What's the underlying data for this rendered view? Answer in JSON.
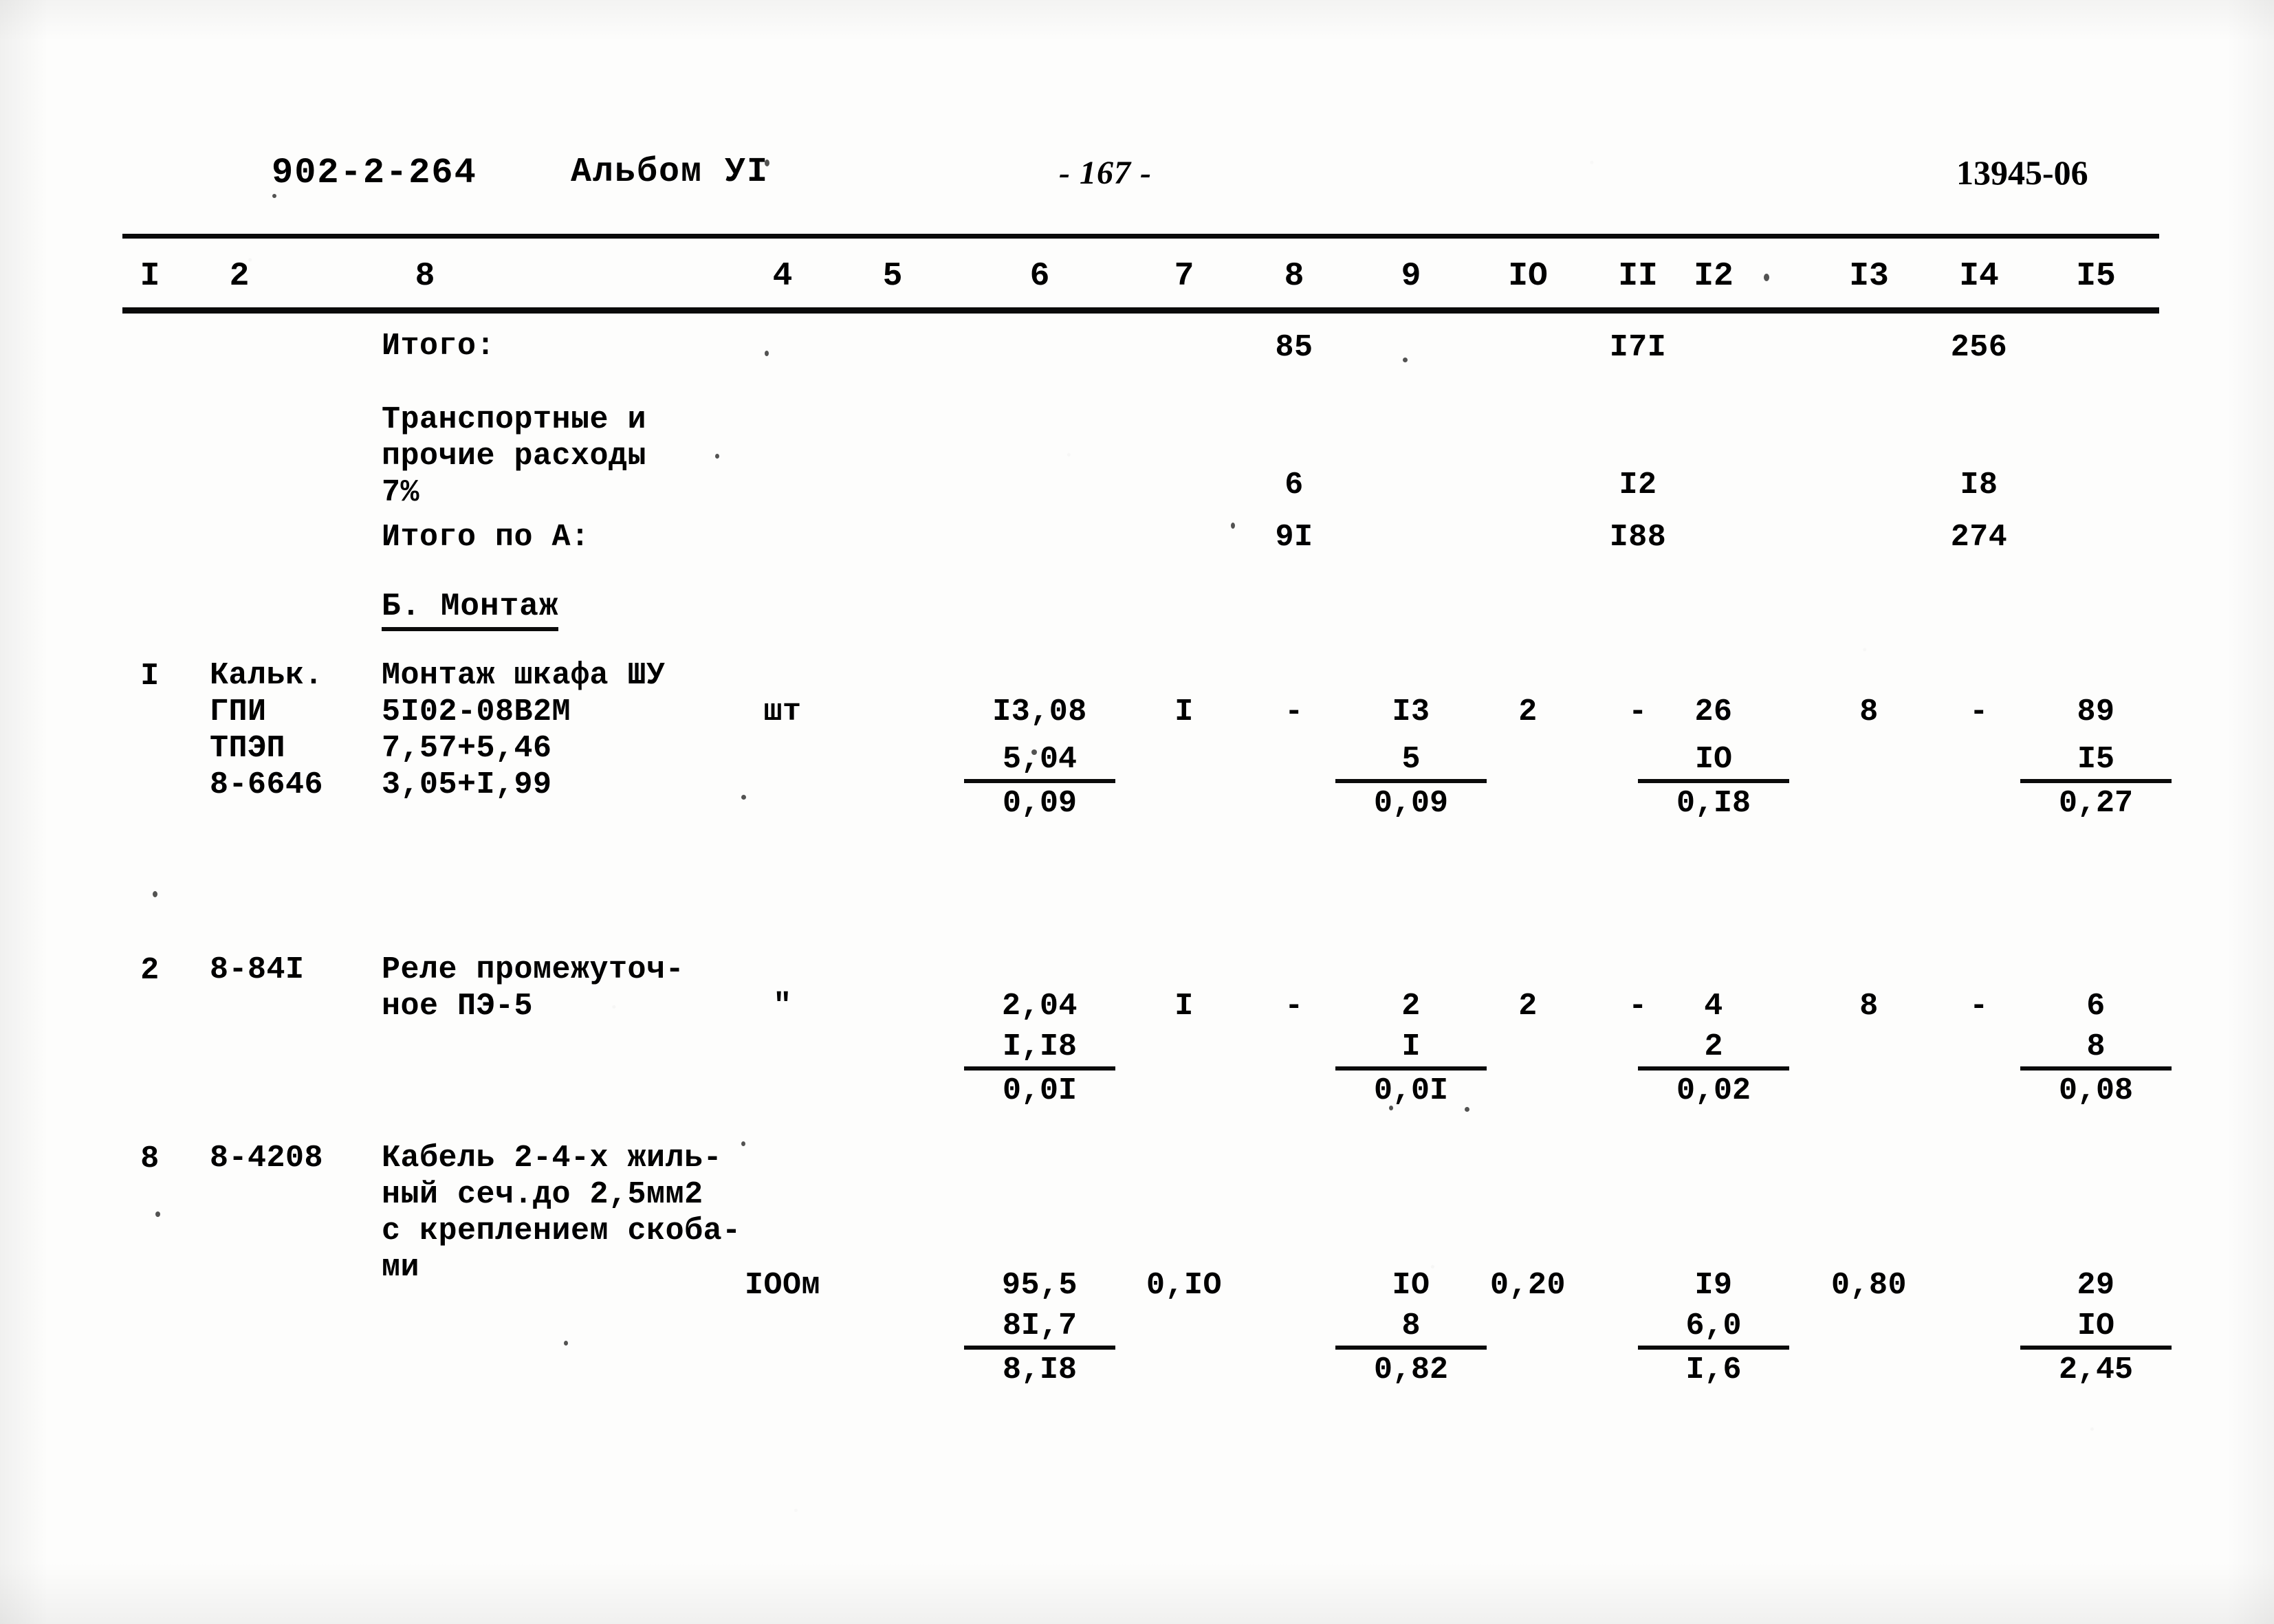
{
  "header": {
    "doc_code": "902-2-264",
    "album": "Альбом УI",
    "page_number": "- 167 -",
    "sheet_code": "13945-06"
  },
  "table": {
    "column_headers": [
      "I",
      "2",
      "8",
      "4",
      "5",
      "6",
      "7",
      "8",
      "9",
      "IO",
      "II",
      "I2",
      "I3",
      "I4",
      "I5"
    ],
    "section_heading": "Б. Монтаж",
    "summary_rows": [
      {
        "label": "Итого:",
        "c8": "85",
        "c11": "I7I",
        "c14": "256"
      },
      {
        "label": "Транспортные и\nпрочие расходы\n7%",
        "c8": "6",
        "c11": "I2",
        "c14": "I8"
      },
      {
        "label": "Итого по А:",
        "c8": "9I",
        "c11": "I88",
        "c14": "274"
      }
    ],
    "rows": [
      {
        "no": "I",
        "code": "Кальк.\nГПИ\nТПЭП\n8-6646",
        "name": "Монтаж шкафа ШУ\n5I02-08B2M\n7,57+5,46\n3,05+I,99",
        "unit": "шт",
        "c6": "I3,08",
        "c7": "I",
        "c8": "-",
        "c9": "I3",
        "c10": "2",
        "c11": "-",
        "c12": "26",
        "c13": "8",
        "c14": "-",
        "c15": "89",
        "frac_c6": {
          "num": "5,04",
          "den": "0,09"
        },
        "frac_c9": {
          "num": "5",
          "den": "0,09"
        },
        "frac_c12": {
          "num": "IO",
          "den": "0,I8"
        },
        "frac_c15": {
          "num": "I5",
          "den": "0,27"
        }
      },
      {
        "no": "2",
        "code": "8-84I",
        "name": "Реле промежуточ-\nное ПЭ-5",
        "unit": "\"",
        "c6": "2,04",
        "c7": "I",
        "c8": "-",
        "c9": "2",
        "c10": "2",
        "c11": "-",
        "c12": "4",
        "c13": "8",
        "c14": "-",
        "c15": "6",
        "frac_c6": {
          "num": "I,I8",
          "den": "0,0I"
        },
        "frac_c9": {
          "num": "I",
          "den": "0,0I"
        },
        "frac_c12": {
          "num": "2",
          "den": "0,02"
        },
        "frac_c15": {
          "num": "8",
          "den": "0,08"
        }
      },
      {
        "no": "8",
        "code": "8-4208",
        "name": "Кабель 2-4-х жиль-\nный сеч.до 2,5мм2\nс креплением скоба-\nми",
        "unit": "IOOм",
        "c6": "95,5",
        "c7": "0,IO",
        "c8": "",
        "c9": "IO",
        "c10": "0,20",
        "c11": "",
        "c12": "I9",
        "c13": "0,80",
        "c14": "",
        "c15": "29",
        "frac_c6": {
          "num": "8I,7",
          "den": "8,I8"
        },
        "frac_c9": {
          "num": "8",
          "den": "0,82"
        },
        "frac_c12": {
          "num": "6,0",
          "den": "I,6"
        },
        "frac_c15": {
          "num": "IO",
          "den": "2,45"
        }
      }
    ]
  },
  "colors": {
    "ink": "#0a0a0a",
    "paper": "#fdfdfc"
  }
}
